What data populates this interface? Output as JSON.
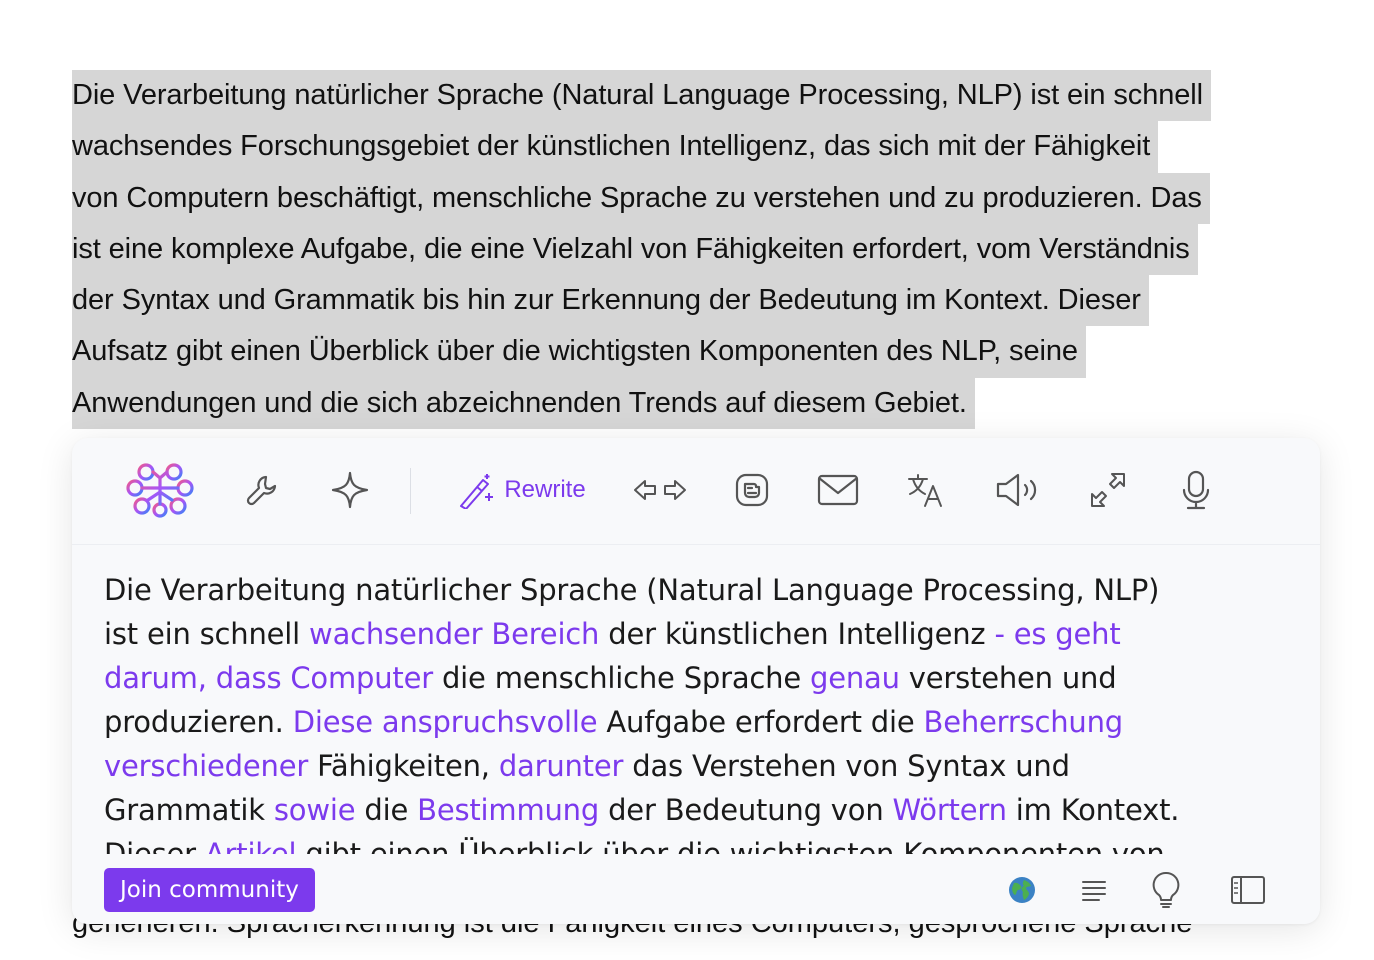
{
  "source_paragraph": {
    "lines": [
      "Die Verarbeitung natürlicher Sprache (Natural Language Processing, NLP) ist ein schnell",
      "wachsendes Forschungsgebiet der künstlichen Intelligenz, das sich mit der Fähigkeit",
      "von Computern beschäftigt, menschliche Sprache zu verstehen und zu produzieren. Das",
      "ist eine komplexe Aufgabe, die eine Vielzahl von Fähigkeiten erfordert, vom Verständnis",
      "der Syntax und Grammatik bis hin zur Erkennung der Bedeutung im Kontext. Dieser",
      "Aufsatz gibt einen Überblick über die wichtigsten Komponenten des NLP, seine",
      "Anwendungen und die sich abzeichnenden Trends auf diesem Gebiet."
    ]
  },
  "behind_text": "generieren. Spracherkennung ist die Fähigkeit eines Computers, gesprochene Sprache",
  "toolbar": {
    "items": [
      {
        "name": "brain-logo-icon"
      },
      {
        "name": "wrench-icon"
      },
      {
        "name": "sparkle-icon"
      },
      {
        "name": "rewrite-button",
        "label": "Rewrite"
      },
      {
        "name": "arrows-left-right-icon"
      },
      {
        "name": "blog-icon"
      },
      {
        "name": "mail-icon"
      },
      {
        "name": "translate-icon"
      },
      {
        "name": "speaker-icon"
      },
      {
        "name": "expand-arrows-icon"
      },
      {
        "name": "microphone-icon"
      }
    ]
  },
  "result": {
    "lines": [
      [
        {
          "t": "Die Verarbeitung natürlicher Sprache (Natural Language Processing, NLP)",
          "hl": false
        }
      ],
      [
        {
          "t": "ist ein schnell ",
          "hl": false
        },
        {
          "t": "wachsender Bereich",
          "hl": true
        },
        {
          "t": " der künstlichen Intelligenz ",
          "hl": false
        },
        {
          "t": "- es geht",
          "hl": true
        }
      ],
      [
        {
          "t": "darum, dass Computer",
          "hl": true
        },
        {
          "t": " die menschliche Sprache ",
          "hl": false
        },
        {
          "t": "genau",
          "hl": true
        },
        {
          "t": " verstehen und",
          "hl": false
        }
      ],
      [
        {
          "t": "produzieren. ",
          "hl": false
        },
        {
          "t": "Diese anspruchsvolle",
          "hl": true
        },
        {
          "t": " Aufgabe erfordert die ",
          "hl": false
        },
        {
          "t": "Beherrschung",
          "hl": true
        }
      ],
      [
        {
          "t": "verschiedener",
          "hl": true
        },
        {
          "t": " Fähigkeiten, ",
          "hl": false
        },
        {
          "t": "darunter",
          "hl": true
        },
        {
          "t": " das Verstehen von Syntax und",
          "hl": false
        }
      ],
      [
        {
          "t": "Grammatik ",
          "hl": false
        },
        {
          "t": "sowie",
          "hl": true
        },
        {
          "t": " die ",
          "hl": false
        },
        {
          "t": "Bestimmung",
          "hl": true
        },
        {
          "t": " der Bedeutung von ",
          "hl": false
        },
        {
          "t": "Wörtern",
          "hl": true
        },
        {
          "t": " im Kontext.",
          "hl": false
        }
      ],
      [
        {
          "t": "Dieser ",
          "hl": false
        },
        {
          "t": "Artikel",
          "hl": true
        },
        {
          "t": " gibt einen Überblick über die wichtigsten Komponenten von",
          "hl": false
        }
      ]
    ]
  },
  "bottombar": {
    "join_label": "Join community",
    "icons": [
      "globe-icon",
      "align-text-icon",
      "lightbulb-icon",
      "sidebar-icon"
    ]
  },
  "colors": {
    "accent": "#7c3aed",
    "selection": "#d6d6d6",
    "panel_bg": "#f8f9fb"
  }
}
